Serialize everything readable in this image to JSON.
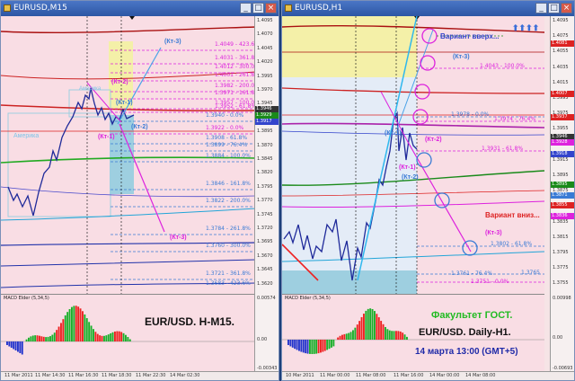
{
  "colors": {
    "title_bar": "#2d56a4",
    "chart_bg": "#f9dde4",
    "up_bar": "#1ab02a",
    "down_bar": "#ee2222",
    "bull_candle": "#1f2a9a",
    "level_magenta": "#dd22dd",
    "level_blue": "#3a7bd5"
  },
  "window_m15": {
    "title": "EURUSD,M15",
    "indicator_label": "MACD Elder (5,34,5)",
    "caption": "EUR/USD. H-M15.",
    "price_ticks": [
      "1.4095",
      "1.4070",
      "1.4045",
      "1.4020",
      "1.3995",
      "1.3970",
      "1.3945",
      "1.3920",
      "1.3895",
      "1.3870",
      "1.3845",
      "1.3820",
      "1.3795",
      "1.3770",
      "1.3745",
      "1.3720",
      "1.3695",
      "1.3670",
      "1.3645",
      "1.3620"
    ],
    "price_boxes": [
      "1.3946",
      "1.3929",
      "1.3917"
    ],
    "macd_ticks": [
      "0.00574",
      "0.00",
      "-0.00343"
    ],
    "time_ticks": [
      "11 Mar 2011",
      "11 Mar 14:30",
      "11 Mar 16:30",
      "11 Mar 18:30",
      "11 Mar 22:30",
      "14 Mar 02:30"
    ],
    "levels": [
      {
        "text": "1.4049 - 423.6%",
        "color": "#dd22dd"
      },
      {
        "text": "1.4031 - 361.8%",
        "color": "#dd22dd"
      },
      {
        "text": "1.4012 - 300.0%",
        "color": "#dd22dd"
      },
      {
        "text": "1.4001 - 261.8%",
        "color": "#dd22dd"
      },
      {
        "text": "1.3982 - 200.0%",
        "color": "#dd22dd"
      },
      {
        "text": "1.3971 - 161.8%",
        "color": "#dd22dd"
      },
      {
        "text": "1.3957 - 100.0%",
        "color": "#dd22dd"
      },
      {
        "text": "1.3952 - 61.8%",
        "color": "#dd22dd"
      },
      {
        "text": "1.3940 - 0.0%",
        "color": "#3a7bd5"
      },
      {
        "text": "1.3922 - 0.0%",
        "color": "#dd22dd"
      },
      {
        "text": "1.3908 - 61.8%",
        "color": "#3a7bd5"
      },
      {
        "text": "1.3899 - 76.4%",
        "color": "#3a7bd5"
      },
      {
        "text": "1.3884 - 100.0%",
        "color": "#3a7bd5"
      },
      {
        "text": "1.3846 - 161.8%",
        "color": "#3a7bd5"
      },
      {
        "text": "1.3822 - 200.0%",
        "color": "#3a7bd5"
      },
      {
        "text": "1.3784 - 261.8%",
        "color": "#3a7bd5"
      },
      {
        "text": "1.3760 - 300.0%",
        "color": "#3a7bd5"
      },
      {
        "text": "1.3721 - 361.8%",
        "color": "#3a7bd5"
      },
      {
        "text": "1.3683 - 423.6%",
        "color": "#3a7bd5"
      }
    ],
    "labels": {
      "kt3_top": "(Кт-3)",
      "kt2": "(Кт-2)",
      "kt1_blue": "(Кт-1)",
      "kt1_mag": "(Кт-1)",
      "kt2_blue": "(Кт-2)",
      "kt3_bottom": "(Кт-3)",
      "ameriga_top": "Америка",
      "ameriga_left": "Америка"
    }
  },
  "window_h1": {
    "title": "EURUSD,H1",
    "indicator_label": "MACD Elder (5,34,5)",
    "arrows": "⬆⬆⬆⬆",
    "price_ticks": [
      "1.4095",
      "1.4075",
      "1.4055",
      "1.4035",
      "1.4015",
      "1.3995",
      "1.3975",
      "1.3955",
      "1.3935",
      "1.3915",
      "1.3895",
      "1.3875",
      "1.3855",
      "1.3835",
      "1.3815",
      "1.3795",
      "1.3775",
      "1.3755"
    ],
    "price_boxes": [
      {
        "text": "1.4081",
        "color": "#dd2222"
      },
      {
        "text": "1.4007",
        "color": "#dd2222"
      },
      {
        "text": "1.3937",
        "color": "#dd2222"
      },
      {
        "text": "1.3946",
        "color": "#333333"
      },
      {
        "text": "1.3928",
        "color": "#dd22dd"
      },
      {
        "text": "1.3918",
        "color": "#3344cc"
      },
      {
        "text": "1.3895",
        "color": "#1a8a1a"
      },
      {
        "text": "1.3871",
        "color": "#3a7bd5"
      },
      {
        "text": "1.3855",
        "color": "#dd2222"
      },
      {
        "text": "1.3836",
        "color": "#dd22dd"
      }
    ],
    "macd_ticks": [
      "0.00998",
      "0.00",
      "-0.00693"
    ],
    "time_ticks": [
      "10 Mar 2011",
      "11 Mar 00:00",
      "11 Mar 08:00",
      "11 Mar 16:00",
      "14 Mar 00:00",
      "14 Mar 08:00"
    ],
    "levels": [
      {
        "text": "1.4043 - 100.0%",
        "color": "#dd22dd"
      },
      {
        "text": "1.3978 - 0.0%",
        "color": "#3a7bd5"
      },
      {
        "text": "1.3974 - 76.4%",
        "color": "#dd22dd"
      },
      {
        "text": "1.3931 - 61.8%",
        "color": "#dd22dd"
      },
      {
        "text": "1.3802 - 61.8%",
        "color": "#3a7bd5"
      },
      {
        "text": "1.3765",
        "color": "#3a7bd5"
      },
      {
        "text": "1.3761 - 76.4%",
        "color": "#3a7bd5"
      },
      {
        "text": "1.3751 - 0.0%",
        "color": "#dd22dd"
      }
    ],
    "labels": {
      "up_variant": "Вариант вверх...",
      "down_variant": "Вариант вниз...",
      "kt3_top": "(Кт-3)",
      "kt1_blue": "(Кт-1)",
      "kt2": "(Кт-2)",
      "kt1_mag": "(Кт-1)",
      "kt2_blue": "(Кт-2)",
      "kt3_bottom": "(Кт-3)"
    },
    "captions": {
      "faculty": "Факультет ГОСТ.",
      "pair": "EUR/USD. Daily-H1.",
      "date": "14 марта  13:00 (GMT+5)"
    }
  }
}
